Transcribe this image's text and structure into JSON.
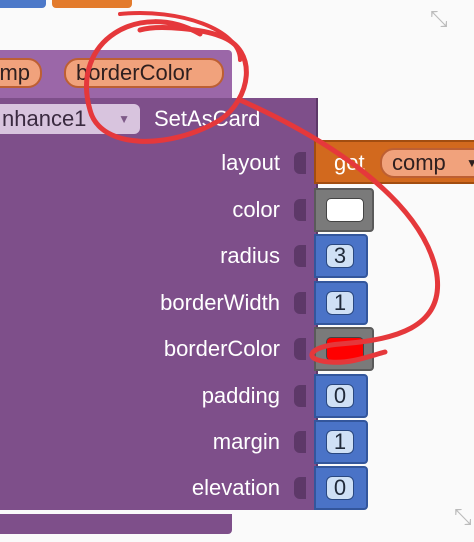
{
  "top_pills": {
    "comp": "mp",
    "border_color": "borderColor"
  },
  "block": {
    "component": "nhance1",
    "method": "SetAsCard"
  },
  "params": [
    {
      "label": "layout"
    },
    {
      "label": "color"
    },
    {
      "label": "radius"
    },
    {
      "label": "borderWidth"
    },
    {
      "label": "borderColor"
    },
    {
      "label": "padding"
    },
    {
      "label": "margin"
    },
    {
      "label": "elevation"
    }
  ],
  "values": {
    "layout_get": "get",
    "layout_var": "comp",
    "color_swatch": "#ffffff",
    "radius": "3",
    "borderWidth": "1",
    "borderColor_swatch": "#ff0000",
    "padding": "0",
    "margin": "1",
    "elevation": "0"
  },
  "colors": {
    "procedure_purple": "#7e4f8a",
    "variable_orange": "#d2691e",
    "math_blue": "#4a73c7",
    "color_gray": "#7a7a7a",
    "annotation_red": "#e5383b"
  },
  "icons": [
    "expand-icon-top-right",
    "expand-icon-bottom-right"
  ]
}
